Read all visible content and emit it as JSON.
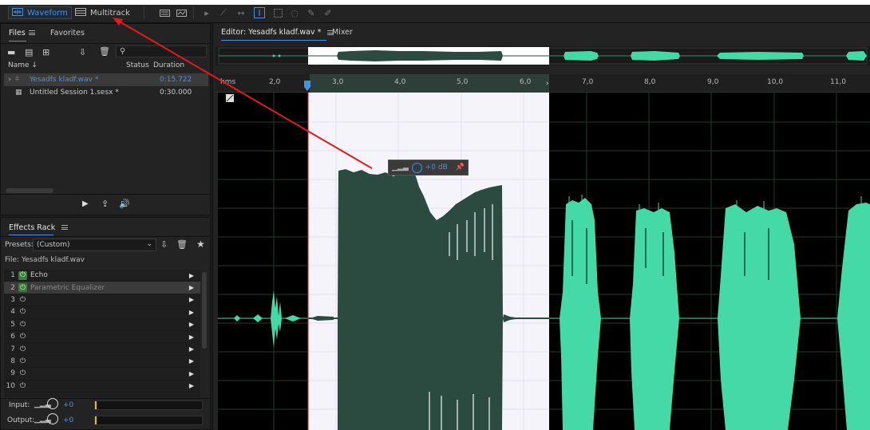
{
  "toolbar": {
    "waveform_label": "Waveform",
    "multitrack_label": "Multitrack"
  },
  "files_panel": {
    "tab_files": "Files",
    "tab_favorites": "Favorites",
    "col_name": "Name",
    "col_status": "Status",
    "col_duration": "Duration",
    "rows": [
      {
        "name": "Yesadfs kladf.wav *",
        "duration": "0:15.722",
        "selected": true
      },
      {
        "name": "Untitled Session 1.sesx *",
        "duration": "0:30.000",
        "selected": false
      }
    ]
  },
  "effects_rack": {
    "title": "Effects Rack",
    "presets_label": "Presets:",
    "preset_value": "(Custom)",
    "file_label": "File: Yesadfs kladf.wav",
    "effects": [
      {
        "num": "1",
        "name": "Echo",
        "on": true
      },
      {
        "num": "2",
        "name": "Parametric Equalizer",
        "on": true
      },
      {
        "num": "3",
        "name": "",
        "on": false
      },
      {
        "num": "4",
        "name": "",
        "on": false
      },
      {
        "num": "5",
        "name": "",
        "on": false
      },
      {
        "num": "6",
        "name": "",
        "on": false
      },
      {
        "num": "7",
        "name": "",
        "on": false
      },
      {
        "num": "8",
        "name": "",
        "on": false
      },
      {
        "num": "9",
        "name": "",
        "on": false
      },
      {
        "num": "10",
        "name": "",
        "on": false
      }
    ],
    "input_label": "Input:",
    "input_value": "+0",
    "output_label": "Output:",
    "output_value": "+0"
  },
  "editor": {
    "tab_editor": "Editor: Yesadfs kladf.wav *",
    "tab_mixer": "Mixer",
    "ruler_unit": "hms",
    "ruler_ticks": [
      "2,0",
      "3,0",
      "4,0",
      "5,0",
      "6,0",
      "7,0",
      "8,0",
      "9,0",
      "10,0",
      "11,0"
    ],
    "hud_gain": "+0 dB"
  },
  "colors": {
    "accent": "#4a90e2",
    "waveform": "#46d9a8",
    "waveform_selected": "#2b4a40",
    "selection_bg": "#f4f4fa",
    "annotation_arrow": "#e31b1b"
  }
}
